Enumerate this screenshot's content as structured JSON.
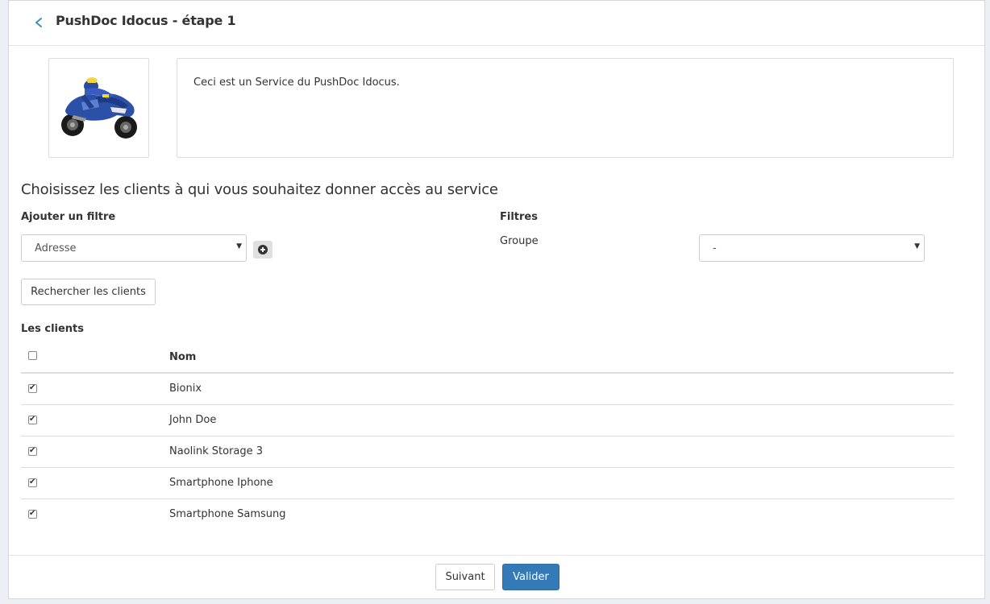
{
  "header": {
    "title": "PushDoc Idocus - étape 1",
    "back_icon": "chevron-left-icon"
  },
  "service": {
    "image_alt": "motorcycle",
    "description": "Ceci est un Service du PushDoc Idocus."
  },
  "section_title": "Choisissez les clients à qui vous souhaitez donner accès au service",
  "filter": {
    "add_label": "Ajouter un filtre",
    "selected": "Adresse",
    "add_icon": "plus-circle-icon"
  },
  "filters": {
    "label": "Filtres",
    "group_label": "Groupe",
    "group_value": "-"
  },
  "search_button": "Rechercher les clients",
  "clients": {
    "label": "Les clients",
    "column_name": "Nom",
    "header_checked": false,
    "rows": [
      {
        "name": "Bionix",
        "checked": true
      },
      {
        "name": "John Doe",
        "checked": true
      },
      {
        "name": "Naolink Storage 3",
        "checked": true
      },
      {
        "name": "Smartphone Iphone",
        "checked": true
      },
      {
        "name": "Smartphone Samsung",
        "checked": true
      }
    ]
  },
  "footer": {
    "next_label": "Suivant",
    "validate_label": "Valider"
  },
  "colors": {
    "primary": "#337ab7",
    "back_icon": "#3c8dbc"
  }
}
